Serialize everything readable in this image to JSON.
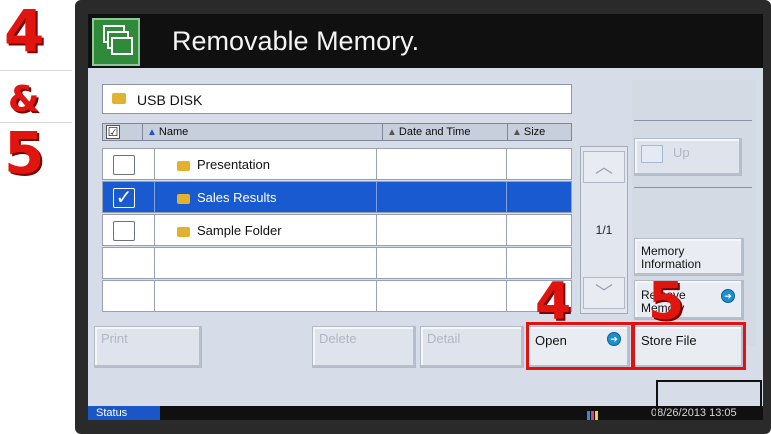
{
  "annotations": {
    "step_a": "4",
    "amp": "&",
    "step_b": "5",
    "open_marker": "4",
    "store_marker": "5",
    "highlight_color": "#e21212"
  },
  "screen": {
    "title": "Removable Memory.",
    "icon": "removable-memory-icon"
  },
  "path": {
    "label": "USB DISK"
  },
  "columns": {
    "name": "Name",
    "date": "Date and Time",
    "size": "Size"
  },
  "rows": [
    {
      "name": "Presentation",
      "checked": false,
      "selected": false
    },
    {
      "name": "Sales Results",
      "checked": true,
      "selected": true
    },
    {
      "name": "Sample Folder",
      "checked": false,
      "selected": false
    }
  ],
  "pager": {
    "page": "1/1"
  },
  "buttons": {
    "print": "Print",
    "delete": "Delete",
    "detail": "Detail",
    "open": "Open",
    "store": "Store File",
    "up": "Up",
    "mem_info_1": "Memory",
    "mem_info_2": "Information",
    "remove_1": "Remove",
    "remove_2": "Memory"
  },
  "statusbar": {
    "label": "Status",
    "datetime": "08/26/2013 13:05"
  },
  "colors": {
    "accent": "#1a5ad1",
    "title_icon": "#2f8a3a"
  }
}
